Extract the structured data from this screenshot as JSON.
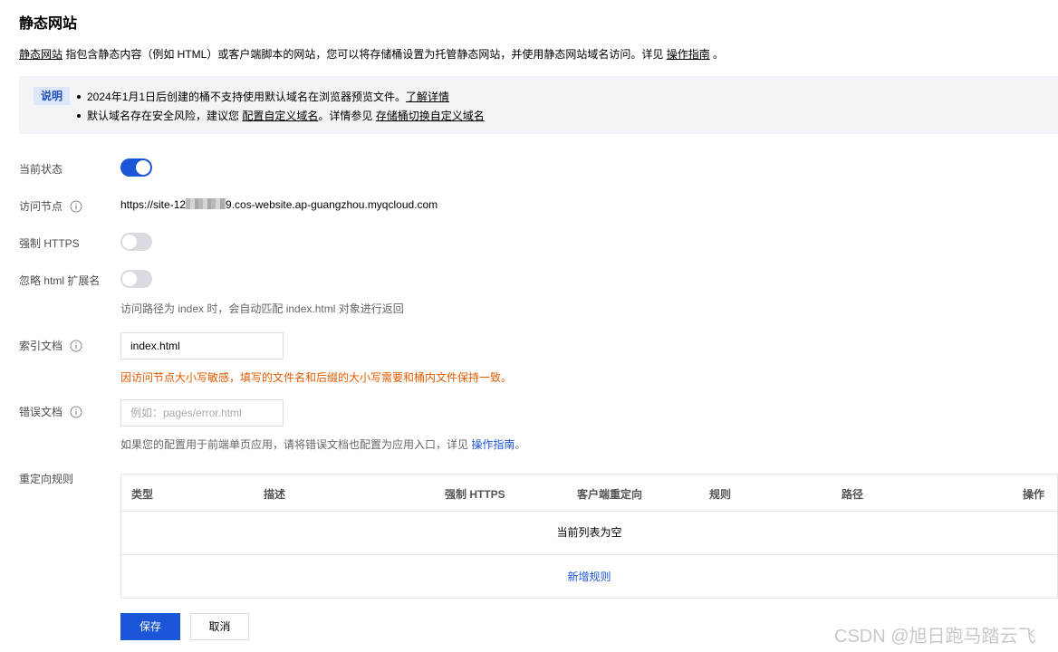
{
  "page": {
    "title": "静态网站",
    "intro": {
      "link_label": "静态网站",
      "text": " 指包含静态内容（例如 HTML）或客户端脚本的网站，您可以将存储桶设置为托管静态网站，并使用静态网站域名访问。详见 ",
      "guide_link": "操作指南",
      "suffix": " 。"
    }
  },
  "notice": {
    "tag": "说明",
    "line1": {
      "text": "2024年1月1日后创建的桶不支持使用默认域名在浏览器预览文件。",
      "link": "了解详情"
    },
    "line2": {
      "text1": "默认域名存在安全风险，建议您 ",
      "link1": "配置自定义域名",
      "text2": "。详情参见 ",
      "link2": "存储桶切换自定义域名"
    }
  },
  "form": {
    "status": {
      "label": "当前状态",
      "enabled": true
    },
    "endpoint": {
      "label": "访问节点",
      "prefix": "https://site-12",
      "suffix": "9.cos-website.ap-guangzhou.myqcloud.com"
    },
    "force_https": {
      "label": "强制 HTTPS",
      "enabled": false
    },
    "ignore_ext": {
      "label": "忽略 html 扩展名",
      "enabled": false,
      "hint": "访问路径为 index 时，会自动匹配 index.html 对象进行返回"
    },
    "index_doc": {
      "label": "索引文档",
      "value": "index.html",
      "warning": "因访问节点大小写敏感，填写的文件名和后缀的大小写需要和桶内文件保持一致。"
    },
    "error_doc": {
      "label": "错误文档",
      "value": "",
      "placeholder": "例如：pages/error.html",
      "hint": "如果您的配置用于前端单页应用，请将错误文档也配置为应用入口，详见 ",
      "hint_link": "操作指南",
      "hint_suffix": "。"
    },
    "redirect": {
      "label": "重定向规则",
      "columns": [
        "类型",
        "描述",
        "强制 HTTPS",
        "客户端重定向",
        "规则",
        "路径",
        "操作"
      ],
      "empty_text": "当前列表为空",
      "add_label": "新增规则"
    }
  },
  "actions": {
    "save": "保存",
    "cancel": "取消"
  },
  "watermark": "CSDN @旭日跑马踏云飞",
  "colors": {
    "accent": "#1b56d8",
    "warning": "#e05a00",
    "notice_bg": "#f3f4f7"
  }
}
